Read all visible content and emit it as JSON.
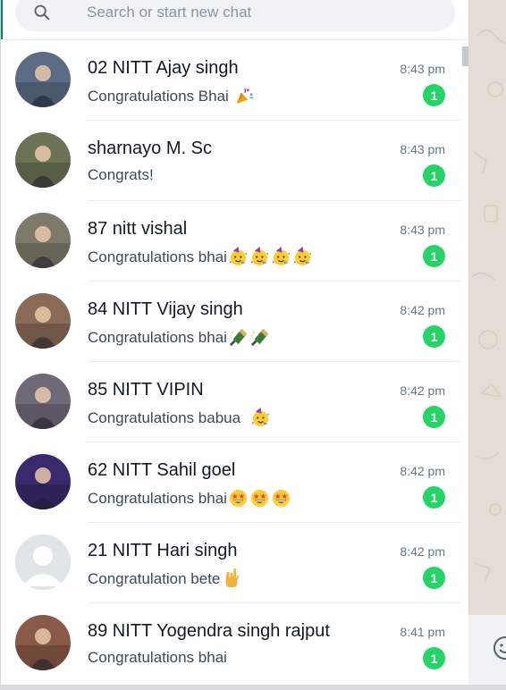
{
  "search": {
    "placeholder": "Search or start new chat",
    "icon": "search-icon"
  },
  "chats": [
    {
      "name": "02 NITT Ajay singh",
      "time": "8:43 pm",
      "preview": "Congratulations Bhai ",
      "emojis": [
        "party-popper"
      ],
      "unread": "1",
      "avatar_color": "#5b6d86"
    },
    {
      "name": "sharnayo M. Sc",
      "time": "8:43 pm",
      "preview": "Congrats!",
      "emojis": [],
      "unread": "1",
      "avatar_color": "#6b7355"
    },
    {
      "name": "87 nitt vishal",
      "time": "8:43 pm",
      "preview": "Congratulations bhai",
      "emojis": [
        "partying-face",
        "partying-face",
        "partying-face",
        "partying-face"
      ],
      "unread": "1",
      "avatar_color": "#7d7a6a"
    },
    {
      "name": "84 NITT Vijay singh",
      "time": "8:42 pm",
      "preview": "Congratulations bhai",
      "emojis": [
        "champagne",
        "champagne"
      ],
      "unread": "1",
      "avatar_color": "#8a6b58"
    },
    {
      "name": "85 NITT VIPIN",
      "time": "8:42 pm",
      "preview": "Congratulations babua  ",
      "emojis": [
        "partying-face"
      ],
      "unread": "1",
      "avatar_color": "#6f6a78"
    },
    {
      "name": "62 NITT Sahil goel",
      "time": "8:42 pm",
      "preview": "Congratulations bhai",
      "emojis": [
        "star-struck",
        "star-struck",
        "star-struck"
      ],
      "unread": "1",
      "avatar_color": "#3a2a6b"
    },
    {
      "name": "21 NITT Hari singh",
      "time": "8:42 pm",
      "preview": "Congratulation bete",
      "emojis": [
        "love-you-gesture"
      ],
      "unread": "1",
      "avatar_color": "#dfe5e7"
    },
    {
      "name": "89 NITT Yogendra singh rajput",
      "time": "8:41 pm",
      "preview": "Congratulations bhai",
      "emojis": [],
      "unread": "1",
      "avatar_color": "#8a5a48"
    }
  ],
  "colors": {
    "accent": "#008069",
    "unread_badge": "#25d366",
    "chat_bg": "#e5ddd5"
  }
}
